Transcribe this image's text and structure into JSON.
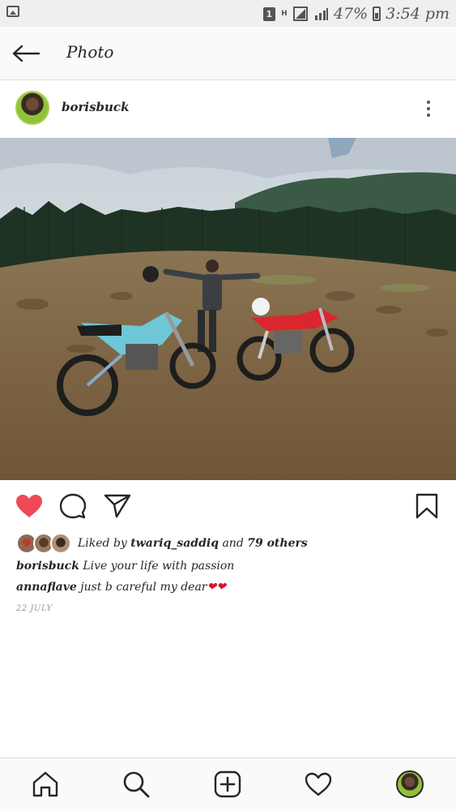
{
  "status_bar": {
    "sim_badge": "1",
    "network": "H",
    "battery_percent": "47%",
    "time": "3:54 pm"
  },
  "nav": {
    "title": "Photo",
    "back_icon": "arrow-left-icon"
  },
  "post": {
    "username": "borisbuck",
    "menu_icon": "more-vertical-icon",
    "liked_by_prefix": "Liked by ",
    "liked_by_user": "twariq_saddiq",
    "liked_by_suffix": " and ",
    "liked_by_others": "79 others",
    "caption_user": "borisbuck",
    "caption_text": " Live your life with passion",
    "comment_user": "annaflave",
    "comment_text": " just b careful my dear",
    "comment_emoji": "❤❤",
    "date": "22 JULY",
    "liked": true
  },
  "actions": {
    "like_icon": "heart-filled-icon",
    "comment_icon": "comment-icon",
    "share_icon": "send-icon",
    "save_icon": "bookmark-icon"
  },
  "bottom_nav": {
    "items": [
      "home-icon",
      "search-icon",
      "add-post-icon",
      "activity-heart-icon",
      "profile-avatar"
    ]
  },
  "colors": {
    "like_red": "#ed4956",
    "text": "#262626",
    "muted": "#999999"
  }
}
